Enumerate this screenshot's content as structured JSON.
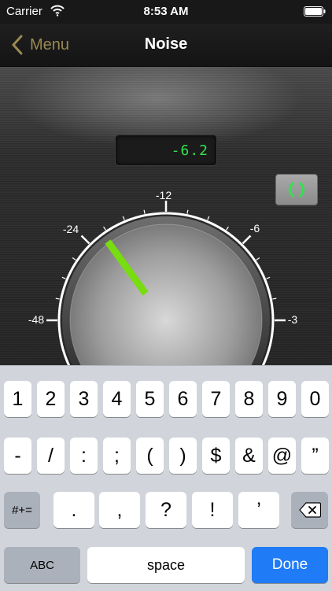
{
  "status_bar": {
    "carrier": "Carrier",
    "time": "8:53 AM"
  },
  "nav": {
    "back_label": "Menu",
    "title": "Noise"
  },
  "readout": {
    "value": "-6.2",
    "color": "#33e050"
  },
  "dial": {
    "labels": {
      "l48": "-48",
      "l24": "-24",
      "l12": "-12",
      "l6": "-6",
      "l3": "-3"
    },
    "pointer_color": "#77dd11"
  },
  "keyboard": {
    "row1": [
      "1",
      "2",
      "3",
      "4",
      "5",
      "6",
      "7",
      "8",
      "9",
      "0"
    ],
    "row2": [
      "-",
      "/",
      ":",
      ";",
      "(",
      ")",
      "$",
      "&",
      "@",
      "”"
    ],
    "row3": {
      "symbols_key": "#+=",
      "keys": [
        ".",
        ",",
        "?",
        "!",
        "’"
      ]
    },
    "row4": {
      "abc_key": "ABC",
      "space_key": "space",
      "done_key": "Done"
    },
    "accent_color": "#1f7bf6"
  }
}
